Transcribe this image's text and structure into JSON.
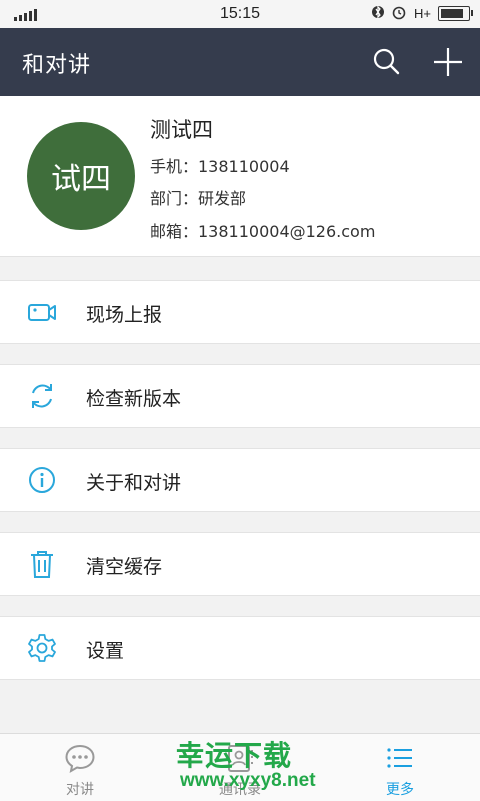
{
  "status_bar": {
    "time": "15:15",
    "network": "H+"
  },
  "header": {
    "title": "和对讲"
  },
  "profile": {
    "avatar_text": "试四",
    "name": "测试四",
    "phone": "手机：138110004",
    "department": "部门：研发部",
    "email": "邮箱：138110004@126.com"
  },
  "menu": {
    "items": [
      {
        "label": "现场上报",
        "icon": "video-camera-icon"
      },
      {
        "label": "检查新版本",
        "icon": "refresh-icon"
      },
      {
        "label": "关于和对讲",
        "icon": "info-icon"
      },
      {
        "label": "清空缓存",
        "icon": "trash-icon"
      },
      {
        "label": "设置",
        "icon": "gear-icon"
      }
    ]
  },
  "bottom_nav": {
    "tabs": [
      {
        "label": "对讲",
        "icon": "chat-bubble-icon",
        "active": false
      },
      {
        "label": "通讯录",
        "icon": "contacts-icon",
        "active": false
      },
      {
        "label": "更多",
        "icon": "list-icon",
        "active": true
      }
    ]
  },
  "watermark": {
    "line1": "幸运下载",
    "line2": "www.xyxy8.net"
  },
  "colors": {
    "header_bg": "#353c4d",
    "avatar_bg": "#3f6e3b",
    "accent": "#1a9fe0",
    "icon_blue": "#2aa7db"
  }
}
